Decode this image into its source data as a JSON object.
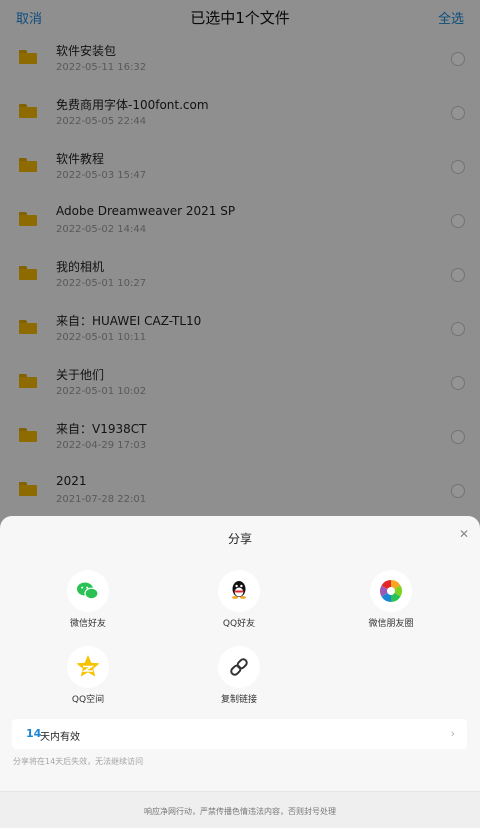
{
  "header": {
    "cancel_label": "取消",
    "title": "已选中1个文件",
    "select_all_label": "全选"
  },
  "files": [
    {
      "name": "软件安装包",
      "date": "2022-05-11  16:32"
    },
    {
      "name": "免费商用字体-100font.com",
      "date": "2022-05-05  22:44"
    },
    {
      "name": "软件教程",
      "date": "2022-05-03  15:47"
    },
    {
      "name": "Adobe Dreamweaver 2021 SP",
      "date": "2022-05-02  14:44"
    },
    {
      "name": "我的相机",
      "date": "2022-05-01  10:27"
    },
    {
      "name": "来自：HUAWEI CAZ-TL10",
      "date": "2022-05-01  10:11"
    },
    {
      "name": "关于他们",
      "date": "2022-05-01  10:02"
    },
    {
      "name": "来自：V1938CT",
      "date": "2022-04-29  17:03"
    },
    {
      "name": "2021",
      "date": "2021-07-28  22:01"
    }
  ],
  "share_sheet": {
    "title": "分享",
    "close_icon": "close-icon",
    "options": [
      {
        "label": "微信好友",
        "icon": "wechat-icon",
        "color": "#2bc255"
      },
      {
        "label": "QQ好友",
        "icon": "qq-icon",
        "color": "#111111"
      },
      {
        "label": "微信朋友圈",
        "icon": "moments-icon",
        "color": "#f5a623"
      },
      {
        "label": "QQ空间",
        "icon": "qzone-icon",
        "color": "#f7c200"
      },
      {
        "label": "复制链接",
        "icon": "link-icon",
        "color": "#333333"
      }
    ],
    "validity": {
      "days": "14",
      "suffix": "天内有效"
    },
    "note": "分享将在14天后失效，无法继续访问",
    "footer": "响应净网行动，严禁传播色情违法内容，否则封号处理"
  },
  "colors": {
    "accent": "#1a86d6",
    "folder": "#f3b800"
  }
}
